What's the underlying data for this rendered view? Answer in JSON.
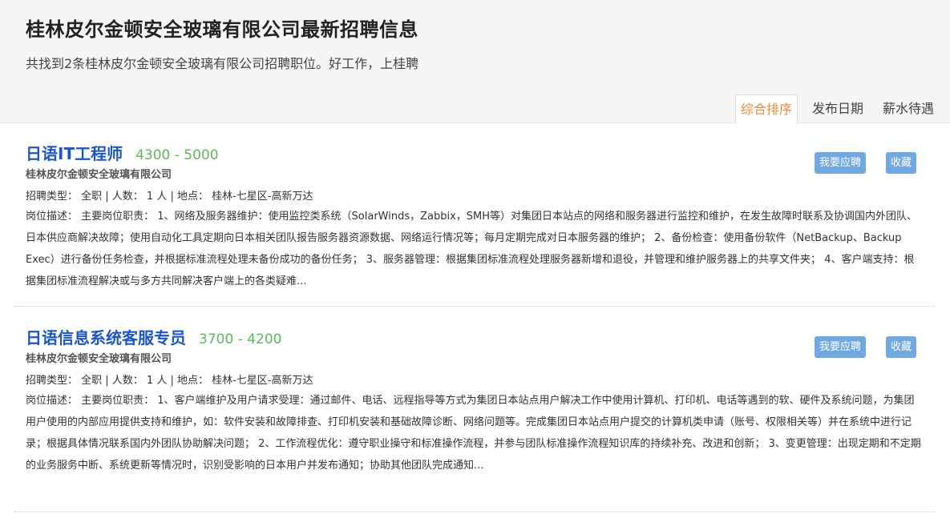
{
  "header": {
    "title": "桂林皮尔金顿安全玻璃有限公司最新招聘信息",
    "subtitle": "共找到2条桂林皮尔金顿安全玻璃有限公司招聘职位。好工作，上桂聘"
  },
  "sort_tabs": [
    {
      "label": "综合排序",
      "active": true
    },
    {
      "label": "发布日期",
      "active": false
    },
    {
      "label": "薪水待遇",
      "active": false
    }
  ],
  "jobs": [
    {
      "title": "日语IT工程师",
      "salary": "4300 - 5000",
      "company": "桂林皮尔金顿安全玻璃有限公司",
      "meta": "招聘类型： 全职 | 人数： 1 人 | 地点： 桂林-七星区-高新万达",
      "description": "岗位描述： 主要岗位职责： 1、网络及服务器维护：使用监控类系统（SolarWinds，Zabbix，SMH等）对集团日本站点的网络和服务器进行监控和维护，在发生故障时联系及协调国内外团队、日本供应商解决故障；使用自动化工具定期向日本相关团队报告服务器资源数据、网络运行情况等；每月定期完成对日本服务器的维护； 2、备份检查：使用备份软件（NetBackup、Backup Exec）进行备份任务检查，并根据标准流程处理未备份成功的备份任务； 3、服务器管理：根据集团标准流程处理服务器新增和退役，并管理和维护服务器上的共享文件夹； 4、客户端支持：根据集团标准流程解决或与多方共同解决客户端上的各类疑难...",
      "apply_label": "我要应聘",
      "fav_label": "收藏"
    },
    {
      "title": "日语信息系统客服专员",
      "salary": "3700 - 4200",
      "company": "桂林皮尔金顿安全玻璃有限公司",
      "meta": "招聘类型： 全职 | 人数： 1 人 | 地点： 桂林-七星区-高新万达",
      "description": "岗位描述： 主要岗位职责： 1、客户端维护及用户请求受理：通过邮件、电话、远程指导等方式为集团日本站点用户解决工作中使用计算机、打印机、电话等遇到的软、硬件及系统问题，为集团用户使用的内部应用提供支持和维护，如：软件安装和故障排查、打印机安装和基础故障诊断、网络问题等。完成集团日本站点用户提交的计算机类申请（账号、权限相关等）并在系统中进行记录；根据具体情况联系国内外团队协助解决问题； 2、工作流程优化：遵守职业操守和标准操作流程，并参与团队标准操作流程知识库的持续补充、改进和创新； 3、变更管理：出现定期和不定期的业务服务中断、系统更新等情况时，识别受影响的日本用户并发布通知；协助其他团队完成通知...",
      "apply_label": "我要应聘",
      "fav_label": "收藏"
    }
  ]
}
